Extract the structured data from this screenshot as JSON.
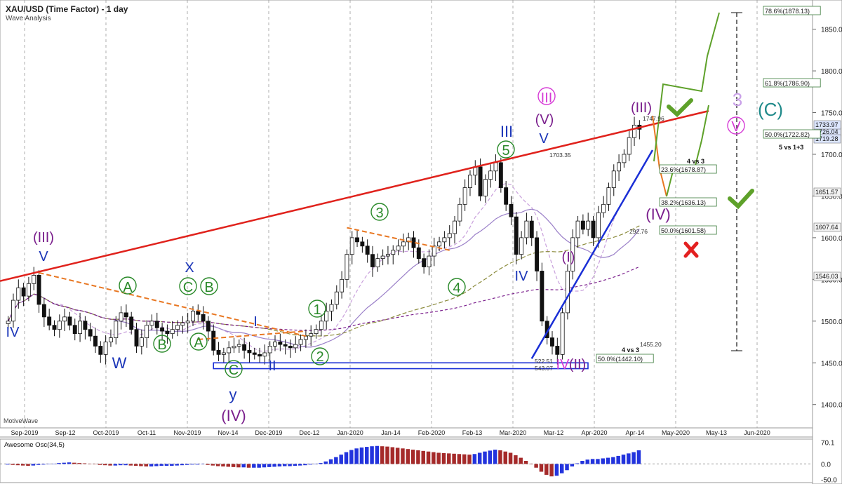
{
  "header": {
    "title": "XAU/USD (Time Factor) - 1 day",
    "subtitle": "Wave Analysis"
  },
  "watermark": "MotiveWave",
  "colors": {
    "up": "#ffffff",
    "down": "#111111",
    "red_line": "#e0221c",
    "blue_line": "#1a2fd6",
    "orange": "#e87722",
    "green": "#5ea12a",
    "purple": "#7a1e8c",
    "magenta": "#d63ad6",
    "teal": "#1f8a8a",
    "wave_blue": "#1b35b8",
    "wave_green": "#2a8a2a",
    "osc_up": "#2233dd",
    "osc_down": "#a52a2a"
  },
  "chart_data": [
    {
      "type": "candlestick",
      "title": "XAU/USD (Time Factor) - 1 day",
      "ylim": [
        1372,
        1885
      ],
      "y_ticks": [
        "1400.00",
        "1450.00",
        "1500.00",
        "1550.00",
        "1600.00",
        "1650.00",
        "1700.00",
        "1750.00",
        "1800.00",
        "1850.00"
      ],
      "x_ticks": [
        "Sep-2019",
        "Sep-12",
        "Oct-2019",
        "Oct-11",
        "Nov-2019",
        "Nov-14",
        "Dec-2019",
        "Dec-12",
        "Jan-2020",
        "Jan-14",
        "Feb-2020",
        "Feb-13",
        "Mar-2020",
        "Mar-12",
        "Apr-2020",
        "Apr-14",
        "May-2020",
        "May-13",
        "Jun-2020"
      ],
      "price_labels": [
        "1726.04",
        "1719.28",
        "1733.97",
        "1651.57",
        "1607.64",
        "1546.03"
      ],
      "closes": [
        1500,
        1525,
        1540,
        1530,
        1545,
        1555,
        1520,
        1505,
        1495,
        1490,
        1500,
        1505,
        1495,
        1485,
        1500,
        1490,
        1482,
        1470,
        1460,
        1475,
        1480,
        1500,
        1510,
        1505,
        1490,
        1470,
        1480,
        1495,
        1500,
        1492,
        1488,
        1485,
        1490,
        1495,
        1498,
        1500,
        1512,
        1508,
        1500,
        1488,
        1465,
        1460,
        1462,
        1468,
        1470,
        1472,
        1465,
        1462,
        1460,
        1458,
        1462,
        1470,
        1475,
        1472,
        1470,
        1468,
        1472,
        1478,
        1482,
        1485,
        1490,
        1500,
        1512,
        1520,
        1535,
        1550,
        1580,
        1600,
        1595,
        1590,
        1580,
        1565,
        1575,
        1578,
        1580,
        1585,
        1590,
        1595,
        1600,
        1588,
        1575,
        1565,
        1578,
        1590,
        1595,
        1600,
        1605,
        1620,
        1640,
        1660,
        1675,
        1685,
        1650,
        1670,
        1680,
        1690,
        1660,
        1640,
        1625,
        1580,
        1600,
        1620,
        1600,
        1560,
        1500,
        1480,
        1470,
        1460,
        1510,
        1560,
        1600,
        1620,
        1610,
        1620,
        1600,
        1630,
        1640,
        1660,
        1680,
        1690,
        1700,
        1720,
        1735,
        1730
      ],
      "annotations": {
        "fib_levels": [
          "78.6%(1878.13)",
          "61.8%(1786.90)",
          "50.0%(1722.82)",
          "23.6%(1678.87)",
          "38.2%(1636.13)",
          "50.0%(1601.58)",
          "50.0%(1442.10)"
        ],
        "price_marks": [
          "1747.96",
          "1703.35",
          "292.76",
          "1455.20",
          "522.51",
          "543.07"
        ],
        "notes": [
          "5 vs 1+3",
          "4 vs 3",
          "4 vs 3"
        ]
      }
    },
    {
      "type": "bar",
      "title": "Awesome Osc(34,5)",
      "ylim": [
        -60,
        80
      ],
      "y_ticks": [
        "70.1",
        "0.0",
        "-50.0"
      ],
      "values": [
        -2,
        -3,
        -4,
        -5,
        -6,
        -5,
        -3,
        -2,
        0,
        1,
        3,
        4,
        5,
        4,
        3,
        2,
        1,
        -1,
        -3,
        -4,
        -5,
        -5,
        -4,
        -4,
        -5,
        -6,
        -7,
        -8,
        -8,
        -7,
        -6,
        -6,
        -6,
        -5,
        -4,
        -3,
        -2,
        -2,
        -1,
        -3,
        -5,
        -7,
        -8,
        -9,
        -10,
        -11,
        -11,
        -12,
        -12,
        -12,
        -11,
        -10,
        -9,
        -8,
        -7,
        -7,
        -6,
        -5,
        -4,
        -2,
        0,
        3,
        8,
        15,
        22,
        30,
        38,
        45,
        50,
        53,
        55,
        57,
        58,
        57,
        56,
        54,
        52,
        50,
        48,
        46,
        44,
        42,
        40,
        38,
        36,
        35,
        34,
        33,
        32,
        31,
        30,
        32,
        36,
        40,
        43,
        46,
        44,
        40,
        36,
        28,
        20,
        10,
        0,
        -12,
        -25,
        -35,
        -40,
        -38,
        -30,
        -20,
        -8,
        2,
        10,
        14,
        16,
        16,
        18,
        20,
        22,
        26,
        30,
        34,
        38,
        44
      ]
    }
  ],
  "wave_labels": [
    "(III)",
    "V",
    "IV",
    "W",
    "X",
    "C",
    "B",
    "A",
    "A",
    "B",
    "C",
    "y",
    "(IV)",
    "I",
    "II",
    "1",
    "2",
    "3",
    "4",
    "5",
    "III",
    "V",
    "IV",
    "III",
    "(V)",
    "(I)",
    "(II)",
    "IV",
    "(III)",
    "(IV)",
    "3",
    "V",
    "(C)"
  ]
}
